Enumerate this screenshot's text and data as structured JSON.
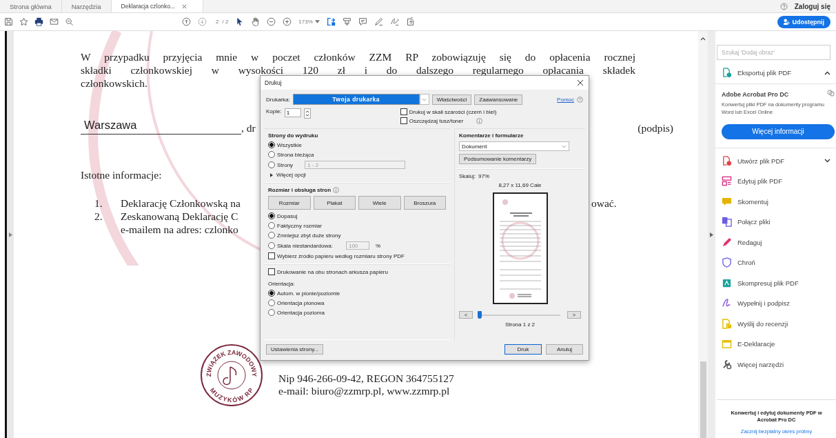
{
  "tabs": [
    {
      "label": "Strona główna",
      "selected": false
    },
    {
      "label": "Narzędzia",
      "selected": false
    },
    {
      "label": "Deklaracja czlonko...",
      "selected": true
    }
  ],
  "account": {
    "sign_in": "Zaloguj się"
  },
  "toolbar": {
    "page": "2",
    "page_count": "/ 2",
    "zoom": "173%",
    "share": "Udostępnij"
  },
  "document": {
    "paragraph": [
      "W przypadku przyjęcia mnie w poczet członków ZZM RP zobowiązuję się do opłacenia rocznej",
      "składki członkowskiej w wysokości 120 zł i do dalszego regularnego opłacania składek",
      "członkowskich."
    ],
    "place": "Warszawa",
    "date_fragment": ", dr",
    "signature": "(podpis)",
    "info_heading": "Istotne informacje:",
    "items": [
      {
        "number": "1.",
        "lines": [
          {
            "left": "Deklarację Członkowską na",
            "right": "ować."
          }
        ]
      },
      {
        "number": "2.",
        "lines": [
          {
            "left": "Zeskanowaną Deklarację C"
          },
          {
            "left": "e-mailem na adres: czlonko"
          }
        ]
      }
    ],
    "stamp": {
      "top": "ZWIĄZEK ZAWODOWY",
      "bottom": "MUZYKÓW RP"
    },
    "footer": [
      "Nip 946-266-09-42, REGON 364755127",
      "e-mail: biuro@zzmrp.pl, www.zzmrp.pl"
    ]
  },
  "print_dialog": {
    "title": "Drukuj",
    "printer_label": "Drukarka:",
    "printer": "Twoja drukarka",
    "buttons": [
      "Właściwości",
      "Zaawansowane"
    ],
    "help": "Pomoc",
    "copies_label": "Kopie:",
    "copies": "1",
    "print_options": [
      {
        "label": "Drukuj w skali szarości (czerń i biel)",
        "checked": false,
        "info": false
      },
      {
        "label": "Oszczędzaj tusz/toner",
        "checked": false,
        "info": true
      }
    ],
    "pages": {
      "heading": "Strony do wydruku",
      "options": [
        {
          "label": "Wszystkie",
          "selected": true
        },
        {
          "label": "Strona bieżąca",
          "selected": false
        },
        {
          "label": "Strony",
          "selected": false,
          "range": "1 - 2"
        }
      ],
      "more": "Więcej opcji",
      "more_expanded": false
    },
    "sizing": {
      "heading": "Rozmiar i obsługa stron",
      "modes": [
        "Rozmiar",
        "Plakat",
        "Wiele",
        "Broszura"
      ],
      "options": [
        {
          "label": "Dopasuj",
          "selected": true
        },
        {
          "label": "Faktyczny rozmiar",
          "selected": false
        },
        {
          "label": "Zmniejsz zbyt duże strony",
          "selected": false
        },
        {
          "label": "Skala niestandardowa:",
          "selected": false,
          "scale": "100",
          "unit": "%"
        }
      ],
      "paper_source": {
        "label": "Wybierz źródło papieru według rozmiaru strony PDF",
        "checked": false
      }
    },
    "duplex": {
      "label": "Drukowanie na obu stronach arkusza papieru",
      "checked": false
    },
    "orientation": {
      "heading": "Orientacja:",
      "options": [
        {
          "label": "Autom. w pionie/poziomie",
          "selected": true
        },
        {
          "label": "Orientacja pionowa",
          "selected": false
        },
        {
          "label": "Orientacja pozioma",
          "selected": false
        }
      ]
    },
    "comments": {
      "heading": "Komentarze i formularze",
      "value": "Dokument",
      "summary": "Podsumowanie komentarzy"
    },
    "preview": {
      "scale_label": "Skaluj:",
      "scale": "97%",
      "paper": "8,27 x 11,69 Cale",
      "prev": "<",
      "next": ">",
      "level": 0,
      "page": "Strona 1 z 2"
    },
    "page_setup": "Ustawienia strony...",
    "print": "Druk",
    "cancel": "Anuluj"
  },
  "tools_panel": {
    "search_placeholder": "Szukaj 'Dodaj obraz'",
    "export": {
      "label": "Eksportuj plik PDF",
      "expanded": true
    },
    "promo": {
      "title": "Adobe Acrobat Pro DC",
      "text": "Konwertuj pliki PDF na dokumenty programu Word lub Excel Online",
      "button": "Więcej informacji"
    },
    "tools": [
      {
        "label": "Utwórz plik PDF",
        "kind": "document",
        "color": "#e0444b",
        "expanded": false
      },
      {
        "label": "Edytuj plik PDF",
        "kind": "layout",
        "color": "#d6287f"
      },
      {
        "label": "Skomentuj",
        "kind": "comment",
        "color": "#e6b400"
      },
      {
        "label": "Połącz pliki",
        "kind": "merge",
        "color": "#6b5de0"
      },
      {
        "label": "Redaguj",
        "kind": "pen",
        "color": "#e0356b"
      },
      {
        "label": "Chroń",
        "kind": "shield",
        "color": "#6f64e8"
      },
      {
        "label": "Skompresuj plik PDF",
        "kind": "compress",
        "color": "#1aa39a"
      },
      {
        "label": "Wypełnij i podpisz",
        "kind": "signature",
        "color": "#8c5de0"
      },
      {
        "label": "Wyślij do recenzji",
        "kind": "note",
        "color": "#e6bf00"
      },
      {
        "label": "E-Deklaracje",
        "kind": "calendar",
        "color": "#e6bf00"
      },
      {
        "label": "Więcej narzędzi",
        "kind": "wrench",
        "color": "#555555"
      }
    ],
    "footer": {
      "title": "Konwertuj i edytuj dokumenty PDF w Acrobat Pro DC",
      "link": "Zacznij bezpłatny okres próbny"
    }
  }
}
